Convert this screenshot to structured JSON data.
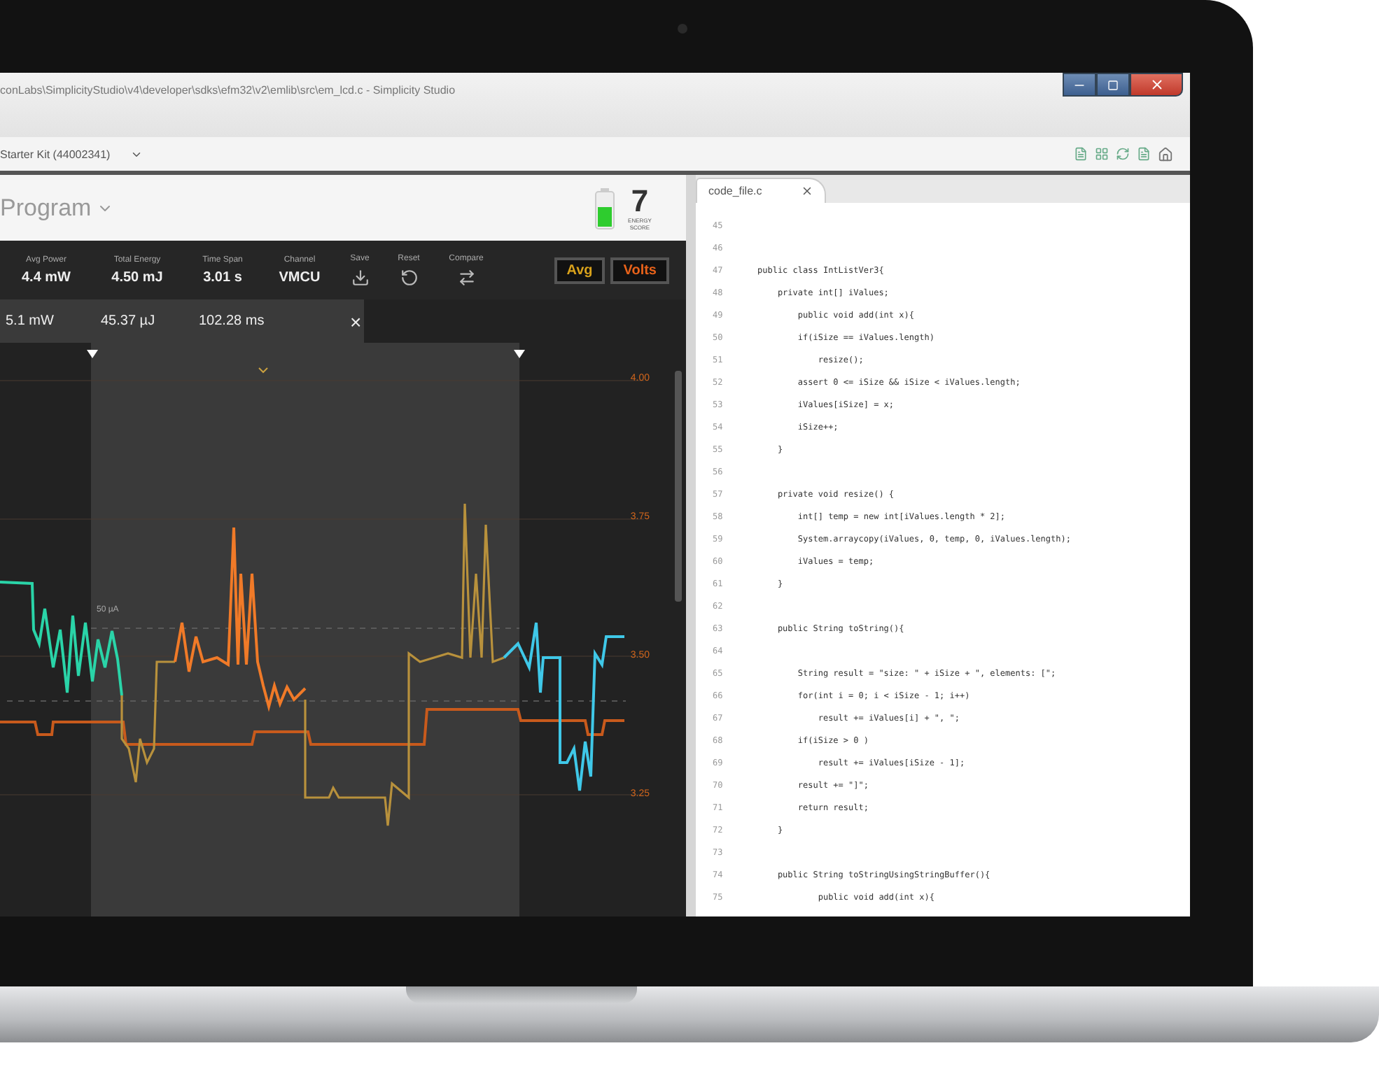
{
  "window": {
    "title": "conLabs\\SimplicityStudio\\v4\\developer\\sdks\\efm32\\v2\\emlib\\src\\em_lcd.c - Simplicity Studio"
  },
  "toolbar": {
    "device": "Starter Kit (44002341)"
  },
  "energy_panel": {
    "title": "Program",
    "score": "7",
    "score_label": "ENERGY SCORE",
    "stats": [
      {
        "kind": "reading",
        "label": "Avg Power",
        "value": "4.4 mW"
      },
      {
        "kind": "reading",
        "label": "Total Energy",
        "value": "4.50 mJ"
      },
      {
        "kind": "reading",
        "label": "Time Span",
        "value": "3.01 s"
      },
      {
        "kind": "reading",
        "label": "Channel",
        "value": "VMCU"
      },
      {
        "kind": "save",
        "label": "Save"
      },
      {
        "kind": "reset",
        "label": "Reset"
      },
      {
        "kind": "compare",
        "label": "Compare"
      }
    ],
    "toggles": [
      {
        "label": "Avg",
        "color": "#d9a21b"
      },
      {
        "label": "Volts",
        "color": "#e8621a"
      }
    ],
    "selection": {
      "values": [
        "5.1 mW",
        "45.37 µJ",
        "102.28 ms"
      ],
      "close": "×"
    },
    "chart": {
      "annotation": "50 µA",
      "y_ticks": [
        "4.00",
        "3.75",
        "3.50",
        "3.25"
      ]
    }
  },
  "editor": {
    "tabs": [
      {
        "label": "code_file.c",
        "selected": true
      }
    ],
    "lines": [
      {
        "number": "45"
      },
      {
        "number": "46"
      },
      {
        "number": "47",
        "text": "public class IntListVer3{"
      },
      {
        "number": "48",
        "text": "    private int[] iValues;"
      },
      {
        "number": "49",
        "text": "        public void add(int x){"
      },
      {
        "number": "50",
        "text": "        if(iSize == iValues.length)"
      },
      {
        "number": "51",
        "text": "            resize();"
      },
      {
        "number": "52",
        "text": "        assert 0 <= iSize && iSize < iValues.length;"
      },
      {
        "number": "53",
        "text": "        iValues[iSize] = x;"
      },
      {
        "number": "54",
        "text": "        iSize++;"
      },
      {
        "number": "55",
        "text": "    }"
      },
      {
        "number": "56"
      },
      {
        "number": "57",
        "text": "    private void resize() {"
      },
      {
        "number": "58",
        "text": "        int[] temp = new int[iValues.length * 2];"
      },
      {
        "number": "59",
        "text": "        System.arraycopy(iValues, 0, temp, 0, iValues.length);"
      },
      {
        "number": "60",
        "text": "        iValues = temp;"
      },
      {
        "number": "61",
        "text": "    }"
      },
      {
        "number": "62"
      },
      {
        "number": "63",
        "text": "    public String toString(){"
      },
      {
        "number": "64"
      },
      {
        "number": "65",
        "text": "        String result = \"size: \" + iSize + \", elements: [\";"
      },
      {
        "number": "66",
        "text": "        for(int i = 0; i < iSize - 1; i++)"
      },
      {
        "number": "67",
        "text": "            result += iValues[i] + \", \";"
      },
      {
        "number": "68",
        "text": "        if(iSize > 0 )"
      },
      {
        "number": "69",
        "text": "            result += iValues[iSize - 1];"
      },
      {
        "number": "70",
        "text": "        result += \"]\";"
      },
      {
        "number": "71",
        "text": "        return result;"
      },
      {
        "number": "72",
        "text": "    }"
      },
      {
        "number": "73"
      },
      {
        "number": "74",
        "text": "    public String toStringUsingStringBuffer(){"
      },
      {
        "number": "75",
        "text": "            public void add(int x){"
      }
    ]
  }
}
